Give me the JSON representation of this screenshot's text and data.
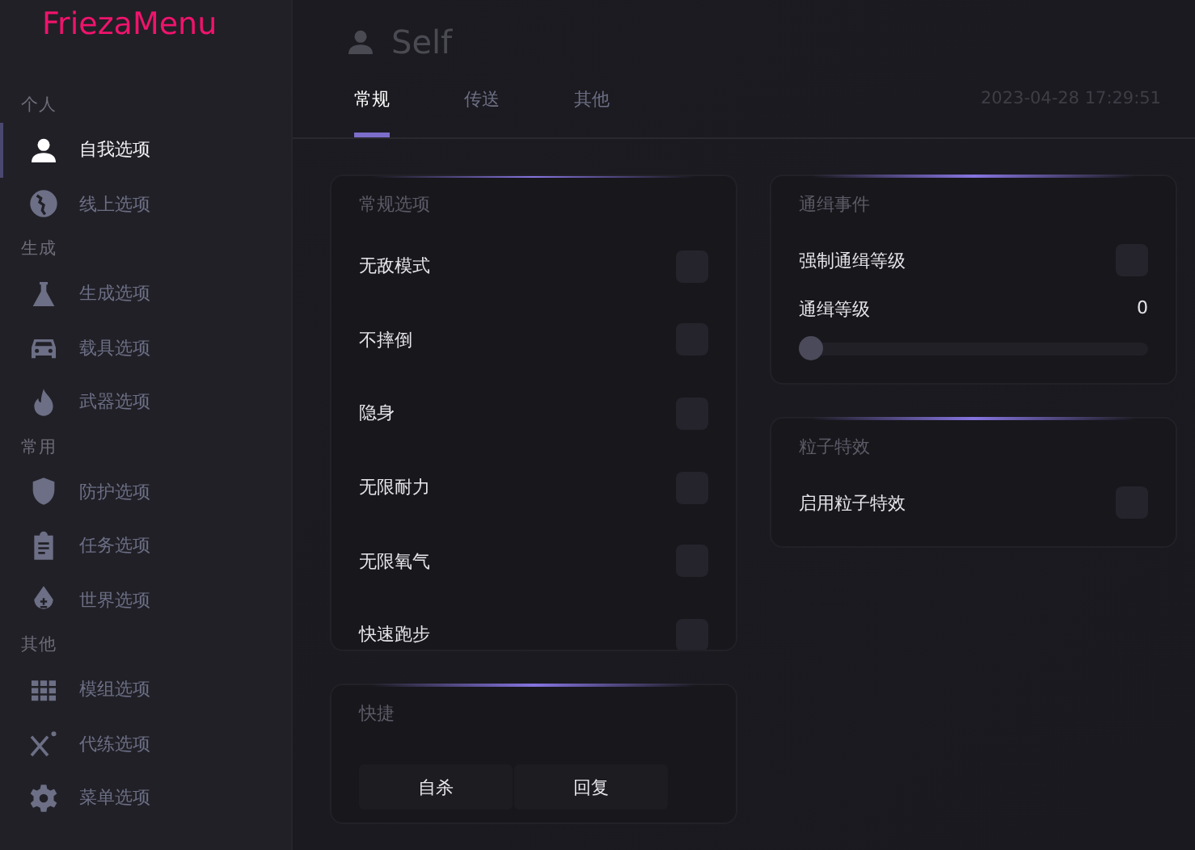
{
  "sidebar": {
    "logo": "FriezaMenu",
    "sections": [
      {
        "label": "个人",
        "items": [
          {
            "label": "自我选项",
            "selected": true
          },
          {
            "label": "线上选项",
            "selected": false
          }
        ]
      },
      {
        "label": "生成",
        "items": [
          {
            "label": "生成选项",
            "selected": false
          },
          {
            "label": "载具选项",
            "selected": false
          },
          {
            "label": "武器选项",
            "selected": false
          }
        ]
      },
      {
        "label": "常用",
        "items": [
          {
            "label": "防护选项",
            "selected": false
          },
          {
            "label": "任务选项",
            "selected": false
          },
          {
            "label": "世界选项",
            "selected": false
          }
        ]
      },
      {
        "label": "其他",
        "items": [
          {
            "label": "模组选项",
            "selected": false
          },
          {
            "label": "代练选项",
            "selected": false
          },
          {
            "label": "菜单选项",
            "selected": false
          }
        ]
      }
    ]
  },
  "header": {
    "title": "Self",
    "datetime": "2023-04-28 17:29:51"
  },
  "tabs": [
    {
      "label": "常规",
      "selected": true
    },
    {
      "label": "传送",
      "selected": false
    },
    {
      "label": "其他",
      "selected": false
    }
  ],
  "left_cards": [
    {
      "title": "常规选项",
      "rows": [
        {
          "kind": "toggle",
          "label": "无敌模式",
          "checked": false
        },
        {
          "kind": "toggle",
          "label": "不摔倒",
          "checked": false
        },
        {
          "kind": "toggle",
          "label": "隐身",
          "checked": false
        },
        {
          "kind": "toggle",
          "label": "无限耐力",
          "checked": false
        },
        {
          "kind": "toggle",
          "label": "无限氧气",
          "checked": false
        },
        {
          "kind": "toggle",
          "label": "快速跑步",
          "checked": false
        }
      ]
    },
    {
      "title": "快捷",
      "buttons": [
        "自杀",
        "回复"
      ]
    }
  ],
  "right_cards": [
    {
      "title": "通缉事件",
      "rows": [
        {
          "kind": "toggle",
          "label": "强制通缉等级",
          "checked": false
        },
        {
          "kind": "slider",
          "label": "通缉等级",
          "reading": "0",
          "level": 0
        }
      ]
    },
    {
      "title": "粒子特效",
      "rows": [
        {
          "kind": "toggle",
          "label": "启用粒子特效",
          "checked": false
        }
      ]
    }
  ]
}
